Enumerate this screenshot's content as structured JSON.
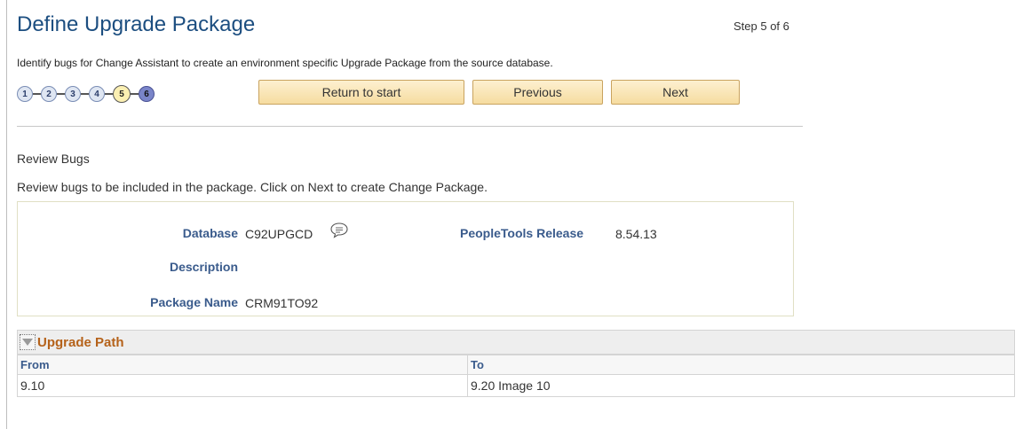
{
  "header": {
    "title": "Define Upgrade Package",
    "step": "Step 5 of 6",
    "instructions": "Identify bugs for Change Assistant to create an environment specific Upgrade Package from the source database."
  },
  "train": {
    "steps": [
      "1",
      "2",
      "3",
      "4",
      "5",
      "6"
    ],
    "current_step": 5
  },
  "buttons": {
    "return_to_start": "Return to start",
    "previous": "Previous",
    "next": "Next"
  },
  "section": {
    "title": "Review Bugs",
    "description": "Review bugs to be included in the package.  Click on Next to create Change Package."
  },
  "fields": {
    "database_label": "Database",
    "database_value": "C92UPGCD",
    "peopletools_label": "PeopleTools Release",
    "peopletools_value": "8.54.13",
    "description_label": "Description",
    "package_label": "Package Name",
    "package_value": "CRM91TO92"
  },
  "upgrade_path": {
    "title": "Upgrade Path",
    "columns": [
      "From",
      "To"
    ],
    "rows": [
      {
        "from": "9.10",
        "to": "9.20 Image 10"
      }
    ]
  },
  "colors": {
    "title": "#1c4e80",
    "label": "#3a5b8c",
    "grid_title": "#b5621a",
    "button": "#f6dca0"
  }
}
